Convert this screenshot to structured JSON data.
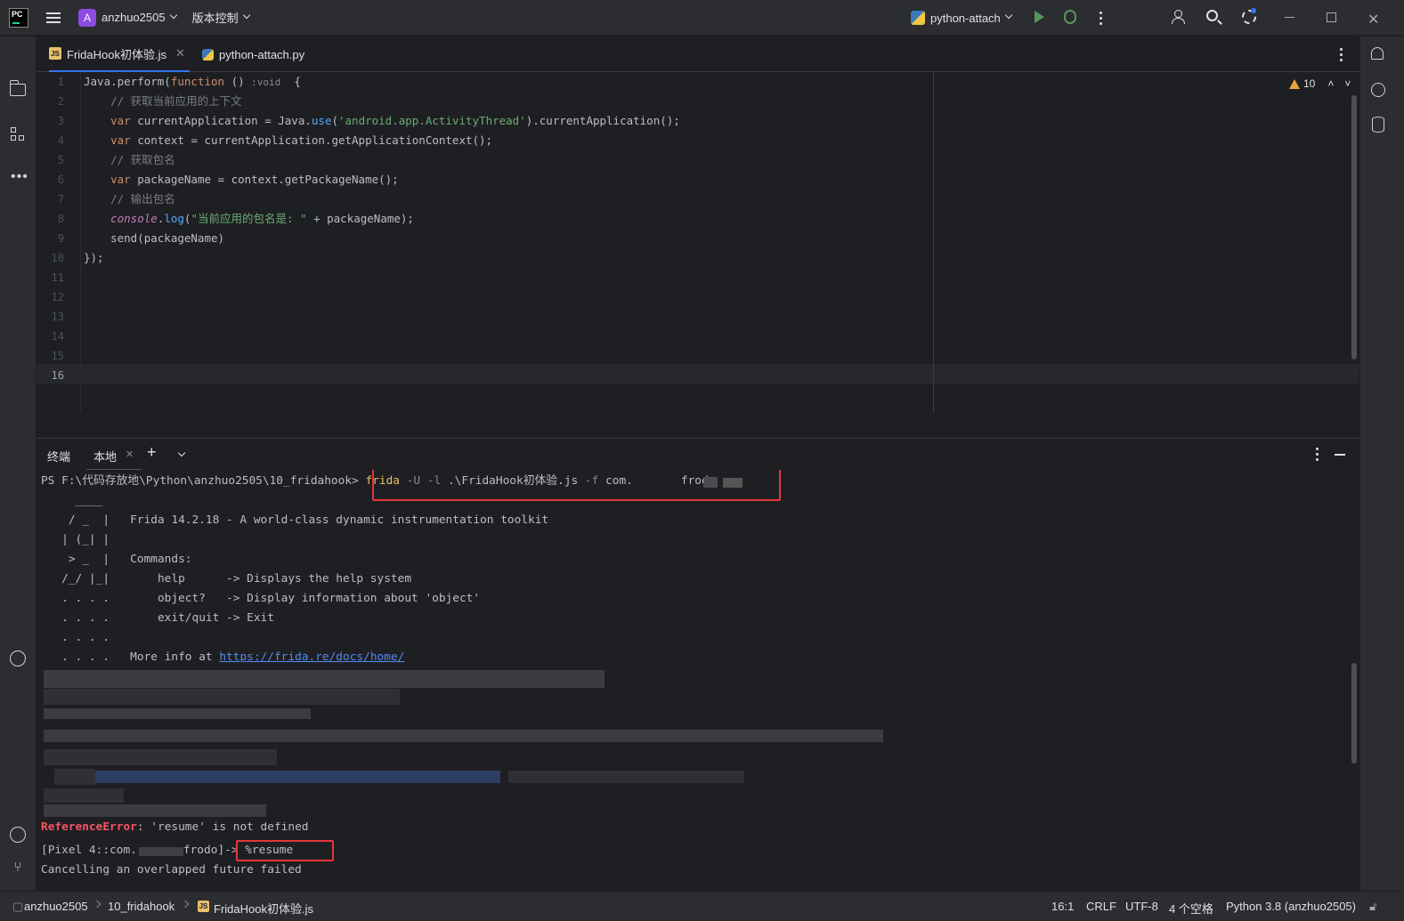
{
  "titlebar": {
    "logo_text": "PC",
    "project_badge": "A",
    "project_name": "anzhuo2505",
    "vcs_menu": "版本控制",
    "run_config": "python-attach"
  },
  "tabs": [
    {
      "label": "FridaHook初体验.js",
      "icon": "js-file-icon"
    },
    {
      "label": "python-attach.py",
      "icon": "python-file-icon"
    }
  ],
  "editor": {
    "warning_count": "10",
    "current_line": 16,
    "line_numbers": [
      "1",
      "2",
      "3",
      "4",
      "5",
      "6",
      "7",
      "8",
      "9",
      "10",
      "11",
      "12",
      "13",
      "14",
      "15",
      "16"
    ],
    "lines": [
      {
        "a": "Java.perform(",
        "b": "function",
        "c": " () ",
        "hint": ":void",
        "d": "  {"
      },
      {
        "comment": "    // 获取当前应用的上下文"
      },
      {
        "a": "    ",
        "kw": "var",
        "b": " currentApplication = Java.",
        "fn": "use",
        "c": "(",
        "str": "'android.app.ActivityThread'",
        "d": ").currentApplication();"
      },
      {
        "a": "    ",
        "kw": "var",
        "b": " context = currentApplication.getApplicationContext();"
      },
      {
        "comment": "    // 获取包名"
      },
      {
        "a": "    ",
        "kw": "var",
        "b": " packageName = context.getPackageName();"
      },
      {
        "comment": "    // 输出包名"
      },
      {
        "a": "    ",
        "v": "console",
        "b": ".",
        "fn": "log",
        "c": "(",
        "str": "\"当前应用的包名是: \"",
        "d": " + packageName);"
      },
      {
        "a": "    send(packageName)"
      },
      {
        "a": "});"
      }
    ]
  },
  "terminal": {
    "tab_title": "终端",
    "local_tab": "本地",
    "prompt": "PS F:\\代码存放地\\Python\\anzhuo2505\\10_fridahook>",
    "cmd_frida": "frida",
    "cmd_flags1": " -U -l ",
    "cmd_file": ".\\FridaHook初体验.js",
    "cmd_flags2": " -f ",
    "cmd_pkg_a": "com.",
    "cmd_pkg_b": "frodo",
    "banner": [
      "     ____",
      "    / _  |   Frida 14.2.18 - A world-class dynamic instrumentation toolkit",
      "   | (_| |",
      "    > _  |   Commands:",
      "   /_/ |_|       help      -> Displays the help system",
      "   . . . .       object?   -> Display information about 'object'",
      "   . . . .       exit/quit -> Exit",
      "   . . . ."
    ],
    "more_info_prefix": "   . . . .   More info at ",
    "more_info_link": "https://frida.re/docs/home/",
    "error_label": "ReferenceError",
    "error_rest": ": 'resume' is not defined",
    "repl_prefix": "[Pixel 4::com.",
    "repl_pkg": "frodo]",
    "repl_cmd": "-> %resume",
    "last_line": "Cancelling an overlapped future failed"
  },
  "statusbar": {
    "breadcrumb": [
      "anzhuo2505",
      "10_fridahook",
      "FridaHook初体验.js"
    ],
    "position": "16:1",
    "line_sep": "CRLF",
    "encoding": "UTF-8",
    "indent": "4 个空格",
    "interpreter": "Python 3.8 (anzhuo2505)"
  },
  "colors": {
    "accent": "#3574f0",
    "highlight_box": "#e5363a",
    "string": "#6aab73",
    "keyword": "#cf8e6d"
  }
}
